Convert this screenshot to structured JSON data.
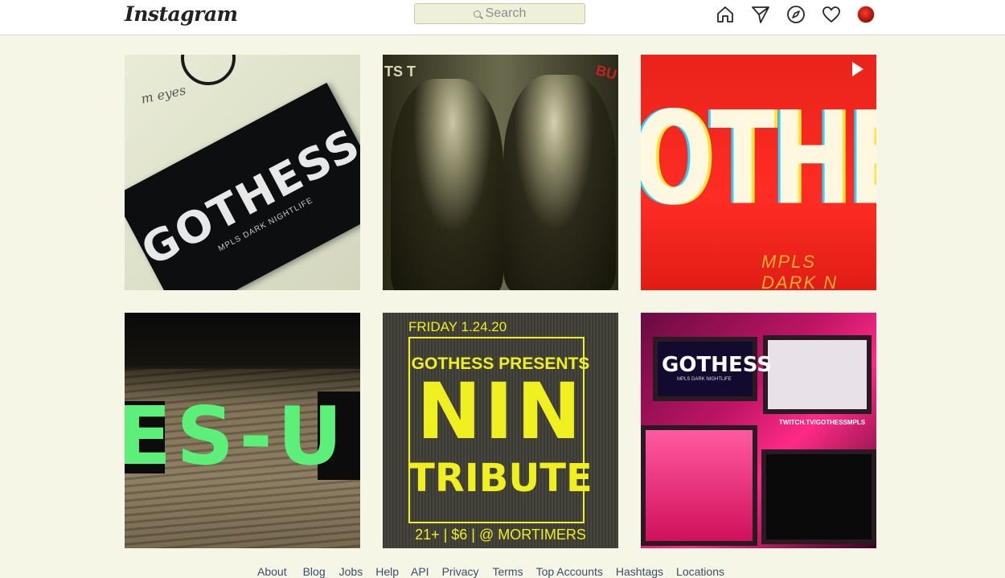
{
  "header": {
    "logo": "Instagram",
    "search_placeholder": "Search",
    "icons": [
      "home-icon",
      "direct-icon",
      "explore-icon",
      "activity-icon",
      "profile-avatar"
    ]
  },
  "posts": [
    {
      "card_title": "GOTHESS",
      "card_subtitle": "MPLS DARK NIGHTLIFE",
      "note": "m eyes"
    },
    {
      "corner_text": "TS T",
      "corner_red": "BU"
    },
    {
      "glitch_text": "OTHES",
      "sub_text": "MPLS DARK N",
      "video": true
    },
    {
      "wood_text": "ES-U"
    },
    {
      "date": "FRIDAY 1.24.20",
      "presents": "GOTHESS PRESENTS",
      "headline": "NIN",
      "subline": "TRIBUTE",
      "footer": "21+ | $6 | @ MORTIMERS"
    },
    {
      "tv_text": "GOTHESS",
      "tv_sub": "MPLS DARK NIGHTLIFE",
      "stream": "TWITCH.TV/GOTHESSMPLS"
    }
  ],
  "footer": {
    "links": [
      "About",
      "Blog",
      "Jobs",
      "Help",
      "API",
      "Privacy",
      "Terms",
      "Top Accounts",
      "Hashtags",
      "Locations"
    ]
  }
}
